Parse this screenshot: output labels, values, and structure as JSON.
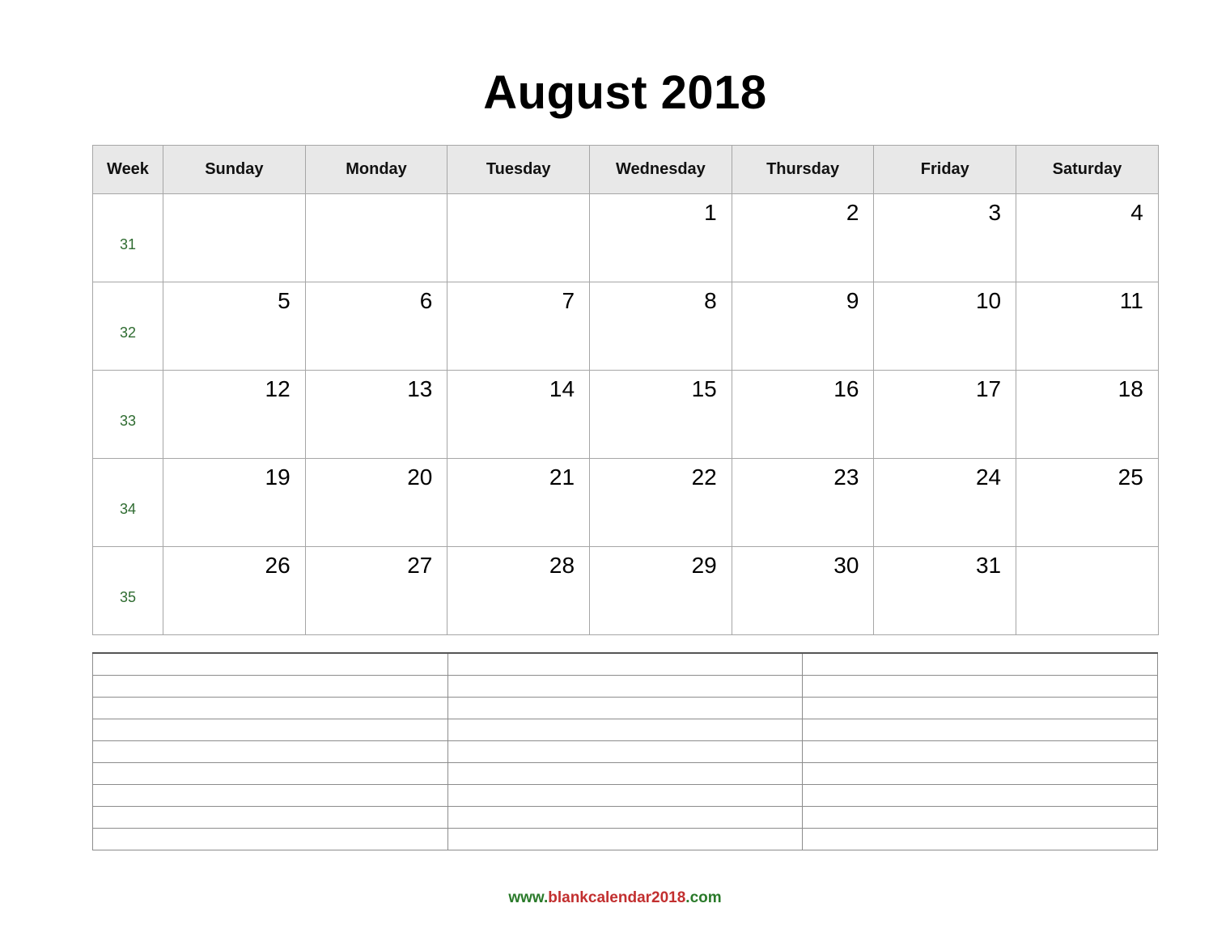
{
  "title": "August 2018",
  "calendar": {
    "week_header": "Week",
    "day_headers": [
      "Sunday",
      "Monday",
      "Tuesday",
      "Wednesday",
      "Thursday",
      "Friday",
      "Saturday"
    ],
    "week_number_color": "#2e6b30",
    "header_background": "#e8e8e8",
    "weeks": [
      {
        "week": "31",
        "days": [
          "",
          "",
          "",
          "1",
          "2",
          "3",
          "4"
        ]
      },
      {
        "week": "32",
        "days": [
          "5",
          "6",
          "7",
          "8",
          "9",
          "10",
          "11"
        ]
      },
      {
        "week": "33",
        "days": [
          "12",
          "13",
          "14",
          "15",
          "16",
          "17",
          "18"
        ]
      },
      {
        "week": "34",
        "days": [
          "19",
          "20",
          "21",
          "22",
          "23",
          "24",
          "25"
        ]
      },
      {
        "week": "35",
        "days": [
          "26",
          "27",
          "28",
          "29",
          "30",
          "31",
          ""
        ]
      }
    ]
  },
  "notes_table": {
    "columns": 3,
    "rows": 9,
    "cells": [
      [
        "",
        "",
        ""
      ],
      [
        "",
        "",
        ""
      ],
      [
        "",
        "",
        ""
      ],
      [
        "",
        "",
        ""
      ],
      [
        "",
        "",
        ""
      ],
      [
        "",
        "",
        ""
      ],
      [
        "",
        "",
        ""
      ],
      [
        "",
        "",
        ""
      ],
      [
        "",
        "",
        ""
      ]
    ]
  },
  "footer": {
    "part_www": "www.",
    "part_name": "blankcalendar2018",
    "part_tld": ".com",
    "green": "#2a7a2a",
    "red": "#c22f2f"
  }
}
